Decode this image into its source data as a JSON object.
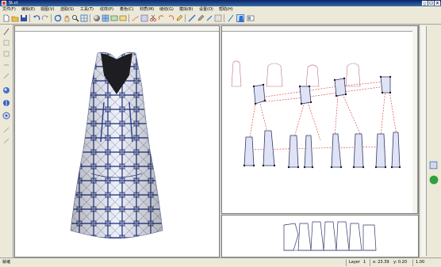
{
  "window": {
    "title": "St.ct"
  },
  "menu": [
    "文件(F)",
    "编辑(E)",
    "视图(V)",
    "选取(S)",
    "工具(T)",
    "纹样(P)",
    "着色(C)",
    "材质(M)",
    "缝纫(G)",
    "模拟(B)",
    "设置(O)",
    "帮助(H)"
  ],
  "status": {
    "left": "就绪",
    "layer_label": "Layer",
    "layer_value": "1",
    "coord_x": "x: 23.39",
    "coord_y": "y: 0.20",
    "zoom": "1.00"
  },
  "colors": {
    "seam_line": "#e03030",
    "pattern_fill": "#dfe3f5",
    "pattern_stroke": "#303868",
    "accent": "#2f6fcf"
  },
  "icons": {
    "toolbar": [
      "new-file-icon",
      "open-file-icon",
      "save-icon",
      "undo-icon",
      "redo-icon",
      "rotate-icon",
      "hand-pan-icon",
      "zoom-icon",
      "fit-view-icon",
      "render-sphere-icon",
      "texture-icon",
      "simulate-icon",
      "material-icon",
      "stitch-icon",
      "ruler-icon",
      "pen-icon",
      "cut-icon",
      "tshirt-icon"
    ]
  }
}
